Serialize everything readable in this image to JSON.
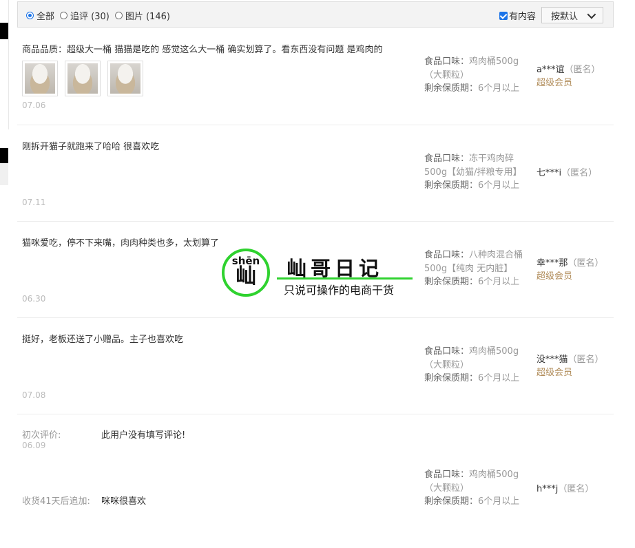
{
  "filter": {
    "options": [
      {
        "label": "全部",
        "checked": true
      },
      {
        "label": "追评 (30)",
        "checked": false
      },
      {
        "label": "图片 (146)",
        "checked": false
      }
    ],
    "has_content_label": "有内容",
    "has_content_checked": true,
    "sort_label": "按默认"
  },
  "reviews": [
    {
      "content": "商品品质：超级大一桶 猫猫是吃的 感觉这么大一桶 确实划算了。看东西没有问题 是鸡肉的",
      "has_images": true,
      "date": "07.06",
      "flavor_label": "食品口味：",
      "flavor_value": "鸡肉桶500g（大颗粒）",
      "shelf_label": "剩余保质期：",
      "shelf_value": "6个月以上",
      "user": "a***谊",
      "anon": "（匿名）",
      "vip": "超级会员"
    },
    {
      "content": "刚拆开猫子就跑来了哈哈 很喜欢吃",
      "has_images": false,
      "date": "07.11",
      "flavor_label": "食品口味：",
      "flavor_value": "冻干鸡肉碎500g【幼猫/拌粮专用】",
      "shelf_label": "剩余保质期：",
      "shelf_value": "6个月以上",
      "user": "七***i",
      "anon": "（匿名）",
      "vip": ""
    },
    {
      "content": "猫咪爱吃，停不下来嘴，肉肉种类也多，太划算了",
      "has_images": false,
      "date": "06.30",
      "flavor_label": "食品口味：",
      "flavor_value": "八种肉混合桶500g【纯肉 无内脏】",
      "shelf_label": "剩余保质期：",
      "shelf_value": "6个月以上",
      "user": "幸***那",
      "anon": "（匿名）",
      "vip": "超级会员"
    },
    {
      "content": "挺好，老板还送了小赠品。主子也喜欢吃",
      "has_images": false,
      "date": "07.08",
      "flavor_label": "食品口味：",
      "flavor_value": "鸡肉桶500g（大颗粒）",
      "shelf_label": "剩余保质期：",
      "shelf_value": "6个月以上",
      "user": "没***猫",
      "anon": "（匿名）",
      "vip": "超级会员"
    }
  ],
  "followup_review": {
    "initial_label": "初次评价:",
    "initial_text": "此用户没有填写评论!",
    "date": "06.09",
    "append_label": "收货41天后追加:",
    "append_text": "咪咪很喜欢",
    "flavor_label": "食品口味：",
    "flavor_value": "鸡肉桶500g（大颗粒）",
    "shelf_label": "剩余保质期：",
    "shelf_value": "6个月以上",
    "user": "h***j",
    "anon": "（匿名）"
  },
  "watermark": {
    "pinyin": "shēn",
    "char": "屾",
    "title": "屾哥日记",
    "subtitle": "只说可操作的电商干货"
  },
  "colors": {
    "accent": "#1a73e8",
    "vip": "#b08b58",
    "watermark_green": "#2fd22f"
  }
}
